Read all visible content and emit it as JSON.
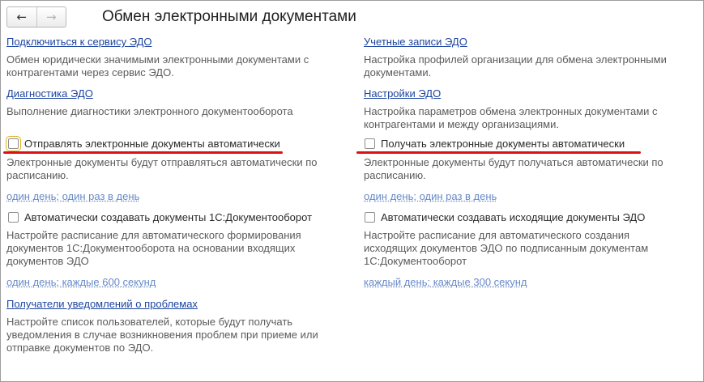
{
  "header": {
    "title": "Обмен электронными документами",
    "back_icon": "←",
    "forward_icon": "→"
  },
  "left": {
    "connect_link": "Подключиться к сервису ЭДО",
    "connect_desc": "Обмен юридически значимыми электронными документами с контрагентами через сервис ЭДО.",
    "diag_link": "Диагностика ЭДО",
    "diag_desc": "Выполнение диагностики электронного документооборота",
    "auto_send_label": "Отправлять электронные документы автоматически",
    "auto_send_desc": "Электронные документы будут отправляться автоматически по расписанию.",
    "auto_send_schedule": "один день; один раз в день",
    "auto_create_label": "Автоматически создавать документы 1С:Документооборот",
    "auto_create_desc": "Настройте расписание для автоматического формирования документов 1С:Документооборота на основании входящих документов ЭДО",
    "auto_create_schedule": "один день; каждые 600 секунд",
    "recipients_link": "Получатели уведомлений о проблемах",
    "recipients_desc": "Настройте список пользователей, которые будут получать уведомления в случае возникновения проблем при приеме или отправке документов по ЭДО."
  },
  "right": {
    "accounts_link": "Учетные записи ЭДО",
    "accounts_desc": "Настройка профилей организации для обмена электронными документами.",
    "settings_link": "Настройки ЭДО",
    "settings_desc": "Настройка параметров обмена электронных документами с контрагентами и между организациями.",
    "auto_receive_label": "Получать электронные документы автоматически",
    "auto_receive_desc": "Электронные документы будут получаться автоматически по расписанию.",
    "auto_receive_schedule": "один день; один раз в день",
    "auto_outgoing_label": "Автоматически создавать исходящие документы ЭДО",
    "auto_outgoing_desc": "Настройте расписание для автоматического создания исходящих документов ЭДО по подписанным документам 1С:Документооборот",
    "auto_outgoing_schedule": "каждый день; каждые 300 секунд"
  },
  "checkboxes": {
    "auto_send": false,
    "auto_create": false,
    "auto_receive": false,
    "auto_outgoing": false
  },
  "colors": {
    "link": "#1d45a0",
    "schedule_link": "#6889c8",
    "description": "#5b5b5b",
    "highlight_underline": "#dd1111"
  }
}
